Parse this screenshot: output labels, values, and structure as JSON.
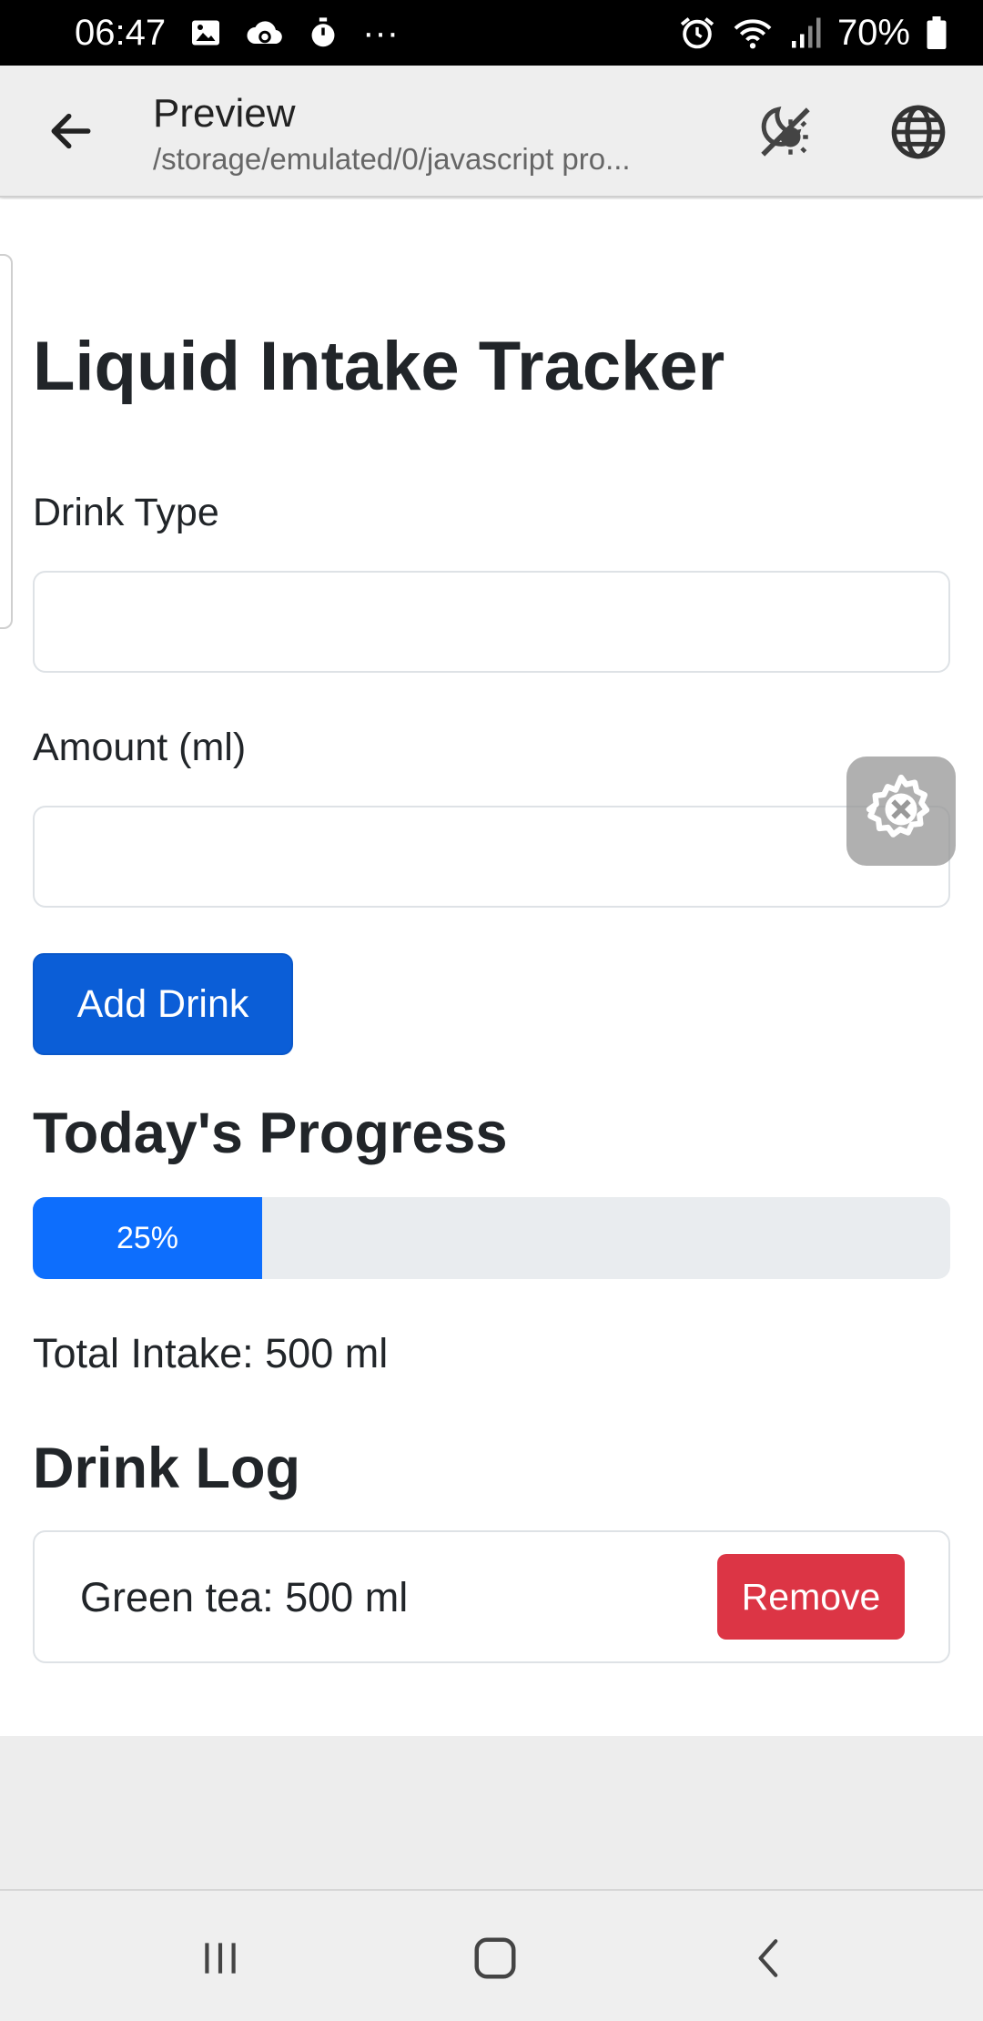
{
  "status_bar": {
    "time": "06:47",
    "more": "···",
    "battery": "70%",
    "icons": [
      "image-icon",
      "cloud-sync-icon",
      "timer-icon",
      "alarm-icon",
      "wifi-icon",
      "signal-icon",
      "battery-icon"
    ]
  },
  "app_bar": {
    "title": "Preview",
    "subtitle": "/storage/emulated/0/javascript pro..."
  },
  "page": {
    "title": "Liquid Intake Tracker",
    "drink_type_label": "Drink Type",
    "drink_type_value": "",
    "amount_label": "Amount (ml)",
    "amount_value": "",
    "add_button": "Add Drink",
    "progress_title": "Today's Progress",
    "progress_value": 25,
    "progress_text": "25%",
    "total_intake": "Total Intake: 500 ml",
    "log_title": "Drink Log",
    "log_items": [
      {
        "text": "Green tea: 500 ml",
        "remove_label": "Remove"
      }
    ]
  },
  "colors": {
    "primary": "#0b5ed7",
    "progress": "#0d6efd",
    "danger": "#dc3545"
  }
}
